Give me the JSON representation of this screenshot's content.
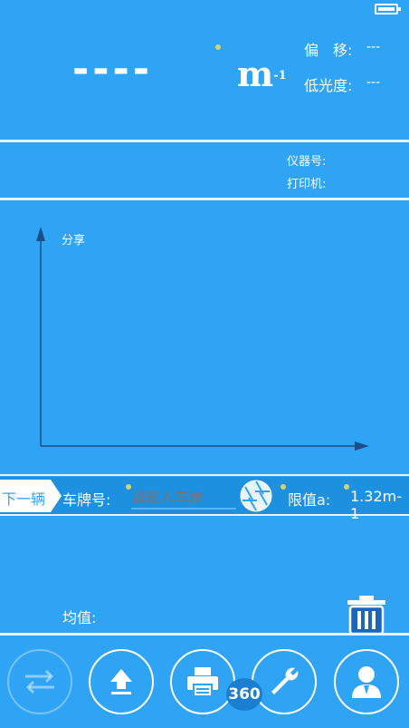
{
  "reading": {
    "value": "----",
    "unit": "m",
    "unit_sup": "-1"
  },
  "status": {
    "offset_label": "偏　移:",
    "offset_value": "---",
    "opacity_label": "低光度:",
    "opacity_value": "---"
  },
  "device": {
    "instrument_label": "仪器号:",
    "printer_label": "打印机:"
  },
  "chart": {
    "y_label": "分享"
  },
  "vehicle": {
    "next_button": "下一辆",
    "plate_label": "车牌号:",
    "plate_placeholder": "请输入车牌",
    "limit_label": "限值a:",
    "limit_value": "1.32m-1"
  },
  "summary": {
    "average_label": "均值:"
  },
  "toolbar": {
    "badge_text": "360",
    "buttons": [
      "switch-icon",
      "upload-icon",
      "printer-icon",
      "wrench-icon",
      "user-icon"
    ]
  },
  "colors": {
    "background": "#2fa4f5",
    "accent_dot": "#d6d36a"
  }
}
